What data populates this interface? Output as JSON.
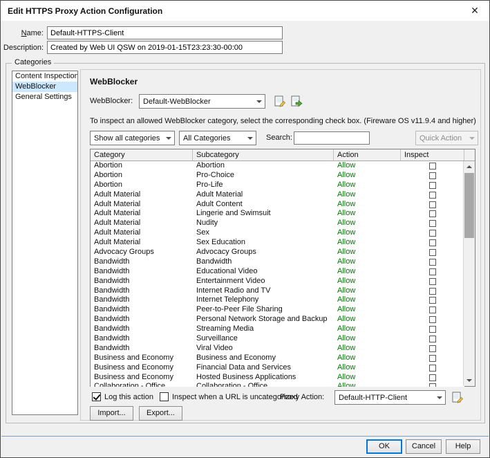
{
  "window": {
    "title": "Edit HTTPS Proxy Action Configuration",
    "close_glyph": "✕"
  },
  "form": {
    "name": {
      "label": "Name:",
      "value": "Default-HTTPS-Client"
    },
    "description": {
      "label": "Description:",
      "value": "Created by Web UI QSW on 2019-01-15T23:23:30-00:00"
    }
  },
  "categories": {
    "group_label": "Categories",
    "items": [
      {
        "label": "Content Inspection",
        "selected": false
      },
      {
        "label": "WebBlocker",
        "selected": true
      },
      {
        "label": "General Settings",
        "selected": false
      }
    ]
  },
  "webblocker": {
    "heading": "WebBlocker",
    "profile": {
      "label": "WebBlocker:",
      "value": "Default-WebBlocker"
    },
    "hint": "To inspect an allowed WebBlocker category, select the corresponding check box. (Fireware OS v11.9.4 and higher)",
    "filters": {
      "category_filter": "Show all categories",
      "subcategory_filter": "All Categories",
      "search_label": "Search:",
      "search_value": "",
      "quick_action_label": "Quick Action"
    },
    "table": {
      "columns": [
        "Category",
        "Subcategory",
        "Action",
        "Inspect"
      ],
      "rows": [
        {
          "category": "Abortion",
          "subcategory": "Abortion",
          "action": "Allow"
        },
        {
          "category": "Abortion",
          "subcategory": "Pro-Choice",
          "action": "Allow"
        },
        {
          "category": "Abortion",
          "subcategory": "Pro-Life",
          "action": "Allow"
        },
        {
          "category": "Adult Material",
          "subcategory": "Adult Material",
          "action": "Allow"
        },
        {
          "category": "Adult Material",
          "subcategory": "Adult Content",
          "action": "Allow"
        },
        {
          "category": "Adult Material",
          "subcategory": "Lingerie and Swimsuit",
          "action": "Allow"
        },
        {
          "category": "Adult Material",
          "subcategory": "Nudity",
          "action": "Allow"
        },
        {
          "category": "Adult Material",
          "subcategory": "Sex",
          "action": "Allow"
        },
        {
          "category": "Adult Material",
          "subcategory": "Sex Education",
          "action": "Allow"
        },
        {
          "category": "Advocacy Groups",
          "subcategory": "Advocacy Groups",
          "action": "Allow"
        },
        {
          "category": "Bandwidth",
          "subcategory": "Bandwidth",
          "action": "Allow"
        },
        {
          "category": "Bandwidth",
          "subcategory": "Educational Video",
          "action": "Allow"
        },
        {
          "category": "Bandwidth",
          "subcategory": "Entertainment Video",
          "action": "Allow"
        },
        {
          "category": "Bandwidth",
          "subcategory": "Internet Radio and TV",
          "action": "Allow"
        },
        {
          "category": "Bandwidth",
          "subcategory": "Internet Telephony",
          "action": "Allow"
        },
        {
          "category": "Bandwidth",
          "subcategory": "Peer-to-Peer File Sharing",
          "action": "Allow"
        },
        {
          "category": "Bandwidth",
          "subcategory": "Personal Network Storage and Backup",
          "action": "Allow"
        },
        {
          "category": "Bandwidth",
          "subcategory": "Streaming Media",
          "action": "Allow"
        },
        {
          "category": "Bandwidth",
          "subcategory": "Surveillance",
          "action": "Allow"
        },
        {
          "category": "Bandwidth",
          "subcategory": "Viral Video",
          "action": "Allow"
        },
        {
          "category": "Business and Economy",
          "subcategory": "Business and Economy",
          "action": "Allow"
        },
        {
          "category": "Business and Economy",
          "subcategory": "Financial Data and Services",
          "action": "Allow"
        },
        {
          "category": "Business and Economy",
          "subcategory": "Hosted Business Applications",
          "action": "Allow"
        },
        {
          "category": "Collaboration - Office",
          "subcategory": "Collaboration - Office",
          "action": "Allow"
        }
      ]
    },
    "options": {
      "log_label": "Log this action",
      "log_checked": true,
      "uncategorized_label": "Inspect when a URL is uncategorized",
      "uncategorized_checked": false,
      "proxy_action_label": "Proxy Action:",
      "proxy_action_value": "Default-HTTP-Client"
    },
    "buttons": {
      "import": "Import...",
      "export": "Export..."
    }
  },
  "footer": {
    "ok": "OK",
    "cancel": "Cancel",
    "help": "Help"
  },
  "colors": {
    "accent": "#0078d7",
    "allow_text": "#007a00",
    "selection": "#cce8ff"
  }
}
